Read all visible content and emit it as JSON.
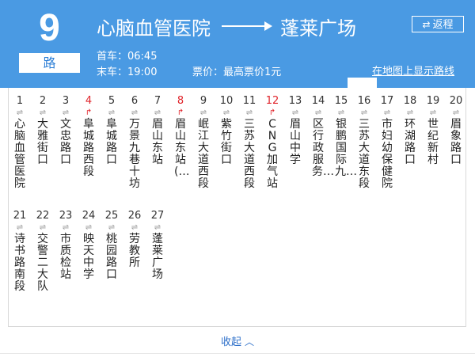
{
  "route": {
    "number": "9",
    "suffix": "路",
    "from": "心脑血管医院",
    "to": "蓬莱广场"
  },
  "header": {
    "return_label": "返程",
    "first_bus": "首车：06:45",
    "last_bus": "末车：19:00",
    "fare": "票价：最高票价1元",
    "map_link": "在地图上显示路线"
  },
  "stops": [
    {
      "num": "1",
      "name": "心脑血管医院",
      "hl": false
    },
    {
      "num": "2",
      "name": "大雅街口",
      "hl": false
    },
    {
      "num": "3",
      "name": "文忠路口",
      "hl": false
    },
    {
      "num": "4",
      "name": "阜城路西段",
      "hl": true
    },
    {
      "num": "5",
      "name": "阜城路口",
      "hl": false
    },
    {
      "num": "6",
      "name": "万景九巷十坊",
      "hl": false
    },
    {
      "num": "7",
      "name": "眉山东站",
      "hl": false
    },
    {
      "num": "8",
      "name": "眉山东站(…",
      "hl": true
    },
    {
      "num": "9",
      "name": "岷江大道西段",
      "hl": false
    },
    {
      "num": "10",
      "name": "紫竹街口",
      "hl": false
    },
    {
      "num": "11",
      "name": "三苏大道西段",
      "hl": false
    },
    {
      "num": "12",
      "name": "CNG加气站",
      "hl": true
    },
    {
      "num": "13",
      "name": "眉山中学",
      "hl": false
    },
    {
      "num": "14",
      "name": "区行政服务…",
      "hl": false
    },
    {
      "num": "15",
      "name": "银鹏国际九…",
      "hl": false
    },
    {
      "num": "16",
      "name": "三苏大道东段",
      "hl": false
    },
    {
      "num": "17",
      "name": "市妇幼保健院",
      "hl": false
    },
    {
      "num": "18",
      "name": "环湖路口",
      "hl": false
    },
    {
      "num": "19",
      "name": "世纪新村",
      "hl": false
    },
    {
      "num": "20",
      "name": "眉象路口",
      "hl": false
    },
    {
      "num": "21",
      "name": "诗书路南段",
      "hl": false
    },
    {
      "num": "22",
      "name": "交警二大队",
      "hl": false
    },
    {
      "num": "23",
      "name": "市质检站",
      "hl": false
    },
    {
      "num": "24",
      "name": "映天中学",
      "hl": false
    },
    {
      "num": "25",
      "name": "桃园路口",
      "hl": false
    },
    {
      "num": "26",
      "name": "劳教所",
      "hl": false
    },
    {
      "num": "27",
      "name": "蓬莱广场",
      "hl": false
    }
  ],
  "icons": {
    "stop_normal": "⇌",
    "stop_highlight": "↱"
  },
  "colors": {
    "header_bg": "#4a9ae3",
    "highlight": "#e0242b",
    "link": "#2d6fc9"
  },
  "footer": {
    "collapse_label": "收起"
  }
}
